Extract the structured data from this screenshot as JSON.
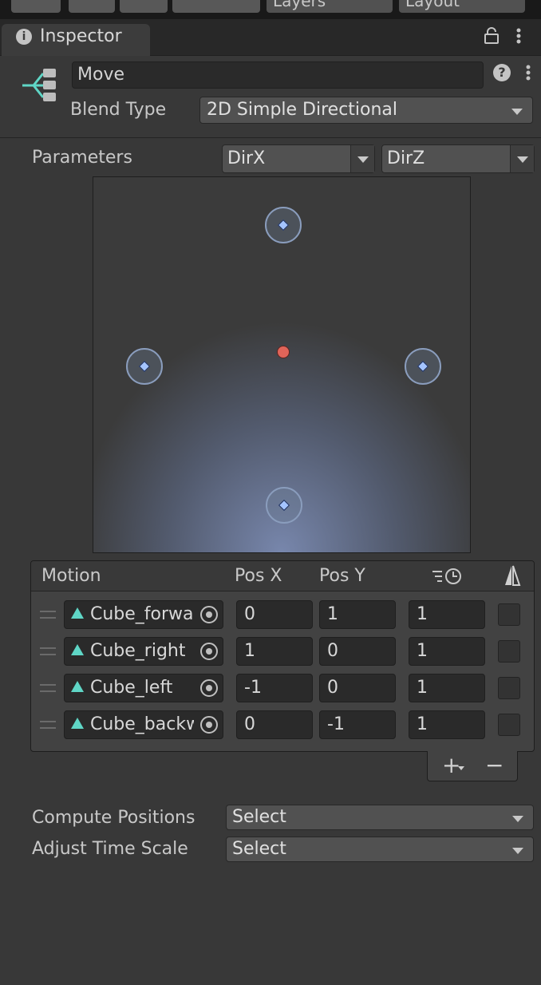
{
  "toolbar": {
    "layers_label": "Layers",
    "layout_label": "Layout"
  },
  "tab": {
    "title": "Inspector"
  },
  "node": {
    "name": "Move"
  },
  "blend": {
    "label": "Blend Type",
    "value": "2D Simple Directional"
  },
  "parameters": {
    "label": "Parameters",
    "x_param": "DirX",
    "y_param": "DirZ"
  },
  "table": {
    "headers": {
      "motion": "Motion",
      "pos_x": "Pos X",
      "pos_y": "Pos Y"
    },
    "rows": [
      {
        "motion": "Cube_forward",
        "pos_x": "0",
        "pos_y": "1",
        "speed": "1"
      },
      {
        "motion": "Cube_right",
        "pos_x": "1",
        "pos_y": "0",
        "speed": "1"
      },
      {
        "motion": "Cube_left",
        "pos_x": "-1",
        "pos_y": "0",
        "speed": "1"
      },
      {
        "motion": "Cube_backward",
        "pos_x": "0",
        "pos_y": "-1",
        "speed": "1"
      }
    ],
    "add_label": "+",
    "remove_label": "−"
  },
  "compute": {
    "label": "Compute Positions",
    "value": "Select"
  },
  "adjust": {
    "label": "Adjust Time Scale",
    "value": "Select"
  },
  "colors": {
    "accent_point": "#a4c4ff",
    "current_point": "#e06459",
    "motion_icon": "#5fd6c6"
  }
}
